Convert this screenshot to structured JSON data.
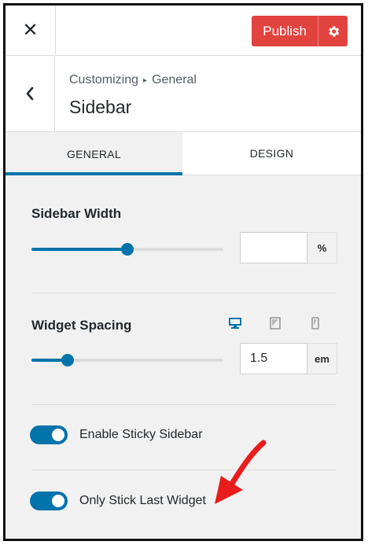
{
  "header": {
    "close_symbol": "✕",
    "publish_label": "Publish",
    "publish_color": "#e2433f"
  },
  "section": {
    "breadcrumb_root": "Customizing",
    "breadcrumb_separator": "▸",
    "breadcrumb_current": "General",
    "title": "Sidebar"
  },
  "tabs": [
    {
      "label": "GENERAL",
      "active": true
    },
    {
      "label": "DESIGN",
      "active": false
    }
  ],
  "sidebar_width": {
    "label": "Sidebar Width",
    "value": "",
    "unit": "%",
    "slider_fraction": 0.5
  },
  "widget_spacing": {
    "label": "Widget Spacing",
    "value": "1.5",
    "unit": "em",
    "slider_fraction": 0.19,
    "devices": [
      "desktop-icon",
      "tablet-icon",
      "mobile-icon"
    ],
    "active_device": "desktop"
  },
  "toggles": [
    {
      "label": "Enable Sticky Sidebar",
      "on": true
    },
    {
      "label": "Only Stick Last Widget",
      "on": true
    }
  ],
  "accent_color": "#0073aa",
  "annotation_arrow_color": "#e81c1c"
}
